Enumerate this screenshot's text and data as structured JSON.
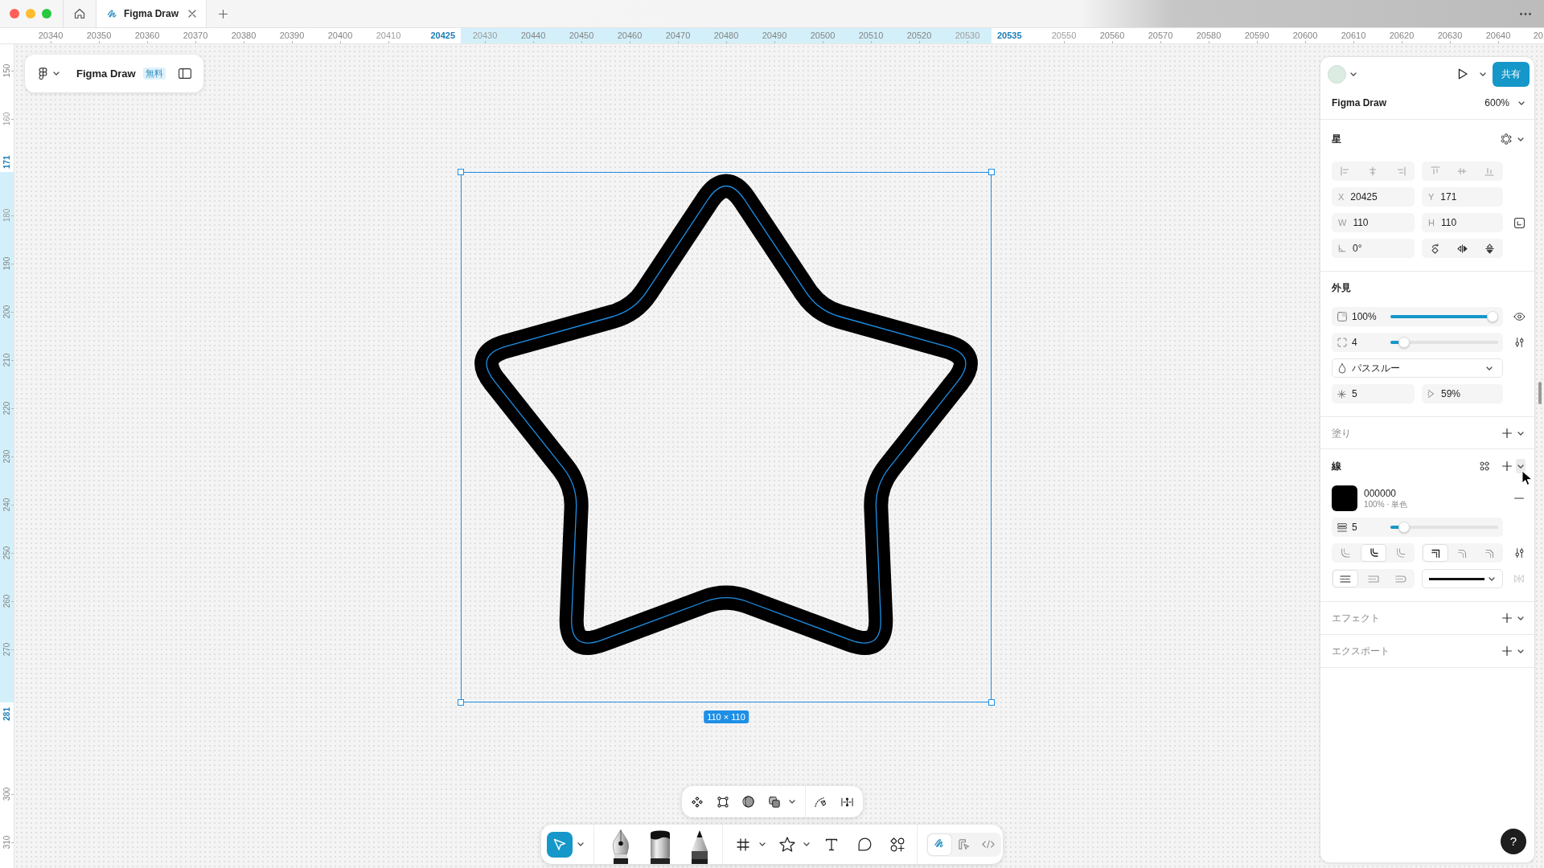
{
  "window": {
    "tabs": [
      {
        "label": "Figma Draw",
        "selected": true
      }
    ]
  },
  "ruler_top": {
    "labels": [
      {
        "text": "20340",
        "kind": "tick"
      },
      {
        "text": "20350",
        "kind": "tick"
      },
      {
        "text": "20360",
        "kind": "tick"
      },
      {
        "text": "20370",
        "kind": "tick"
      },
      {
        "text": "20380",
        "kind": "tick"
      },
      {
        "text": "20390",
        "kind": "tick"
      },
      {
        "text": "20400",
        "kind": "tick"
      },
      {
        "text": "20410",
        "kind": "faded"
      },
      {
        "text": "20425",
        "kind": "selection_start"
      },
      {
        "text": "20430",
        "kind": "faded"
      },
      {
        "text": "20440",
        "kind": "tick"
      },
      {
        "text": "20450",
        "kind": "tick"
      },
      {
        "text": "20460",
        "kind": "tick"
      },
      {
        "text": "20470",
        "kind": "tick"
      },
      {
        "text": "20480",
        "kind": "tick"
      },
      {
        "text": "20490",
        "kind": "tick"
      },
      {
        "text": "20500",
        "kind": "tick"
      },
      {
        "text": "20510",
        "kind": "tick"
      },
      {
        "text": "20520",
        "kind": "tick"
      },
      {
        "text": "20530",
        "kind": "faded"
      },
      {
        "text": "20535",
        "kind": "selection_end"
      },
      {
        "text": "20550",
        "kind": "faded"
      },
      {
        "text": "20560",
        "kind": "tick"
      },
      {
        "text": "20570",
        "kind": "tick"
      },
      {
        "text": "20580",
        "kind": "tick"
      },
      {
        "text": "20590",
        "kind": "tick"
      },
      {
        "text": "20600",
        "kind": "tick"
      },
      {
        "text": "20610",
        "kind": "tick"
      },
      {
        "text": "20620",
        "kind": "tick"
      },
      {
        "text": "20630",
        "kind": "tick"
      },
      {
        "text": "20640",
        "kind": "tick"
      },
      {
        "text": "20",
        "kind": "edge"
      }
    ]
  },
  "ruler_left": {
    "labels": [
      {
        "text": "150",
        "kind": "tick"
      },
      {
        "text": "160",
        "kind": "faded"
      },
      {
        "text": "171",
        "kind": "selection_start"
      },
      {
        "text": "180",
        "kind": "faded"
      },
      {
        "text": "190",
        "kind": "tick"
      },
      {
        "text": "200",
        "kind": "tick"
      },
      {
        "text": "210",
        "kind": "tick"
      },
      {
        "text": "220",
        "kind": "tick"
      },
      {
        "text": "230",
        "kind": "tick"
      },
      {
        "text": "240",
        "kind": "tick"
      },
      {
        "text": "250",
        "kind": "tick"
      },
      {
        "text": "260",
        "kind": "tick"
      },
      {
        "text": "270",
        "kind": "tick"
      },
      {
        "text": "281",
        "kind": "selection_end"
      },
      {
        "text": "300",
        "kind": "tick"
      },
      {
        "text": "310",
        "kind": "tick"
      }
    ]
  },
  "file_card": {
    "title": "Figma Draw",
    "badge": "無料"
  },
  "canvas": {
    "selection_size": "110 × 110"
  },
  "floating_toolbar": {
    "groups": [
      {
        "actions": [
          {
            "kind": "component",
            "menu": false
          },
          {
            "kind": "frame_selection",
            "menu": false
          },
          {
            "kind": "mask",
            "menu": false
          },
          {
            "kind": "boolean",
            "menu": true
          }
        ]
      },
      {
        "actions": [
          {
            "kind": "path_edit",
            "menu": false
          },
          {
            "kind": "distribute",
            "menu": false
          }
        ]
      }
    ]
  },
  "toolbar": {
    "groups": [
      {
        "tools": [
          {
            "kind": "move",
            "selected": true,
            "menu": true
          }
        ]
      },
      {
        "tools": [
          {
            "kind": "pen",
            "selected": false,
            "menu": false
          },
          {
            "kind": "marker",
            "selected": false,
            "menu": false
          },
          {
            "kind": "pencil",
            "selected": false,
            "menu": false
          }
        ]
      },
      {
        "tools": [
          {
            "kind": "frame",
            "selected": false,
            "menu": true
          },
          {
            "kind": "star",
            "selected": false,
            "menu": true
          },
          {
            "kind": "text",
            "selected": false,
            "menu": false
          },
          {
            "kind": "shape",
            "selected": false,
            "menu": false
          },
          {
            "kind": "assets",
            "selected": false,
            "menu": false
          }
        ]
      }
    ],
    "modes": [
      {
        "kind": "draw",
        "selected": true
      },
      {
        "kind": "design",
        "selected": false
      },
      {
        "kind": "dev",
        "selected": false
      }
    ]
  },
  "properties": {
    "header": {
      "share": "共有",
      "file_name": "Figma Draw",
      "zoom": "600%"
    },
    "layer": {
      "title": "星"
    },
    "transform": {
      "x": {
        "label": "X",
        "value": "20425"
      },
      "y": {
        "label": "Y",
        "value": "171"
      },
      "w": {
        "label": "W",
        "value": "110"
      },
      "h": {
        "label": "H",
        "value": "110"
      },
      "rotation": "0°"
    },
    "appearance": {
      "title": "外見",
      "opacity": {
        "value": "100%",
        "level": 1
      },
      "corner_radius": {
        "value": "4",
        "level": 0.08
      },
      "blend_mode": "パススルー",
      "point_count": "5",
      "ratio": "59%"
    },
    "fill": {
      "title": "塗り",
      "empty": true
    },
    "stroke": {
      "title": "線",
      "empty": false,
      "menu_hovered": true,
      "hex_code": "000000",
      "detail": "100% · 単色",
      "weight": {
        "value": "5",
        "level": 0.08
      },
      "position_options": [
        {
          "selected": false
        },
        {
          "selected": true
        },
        {
          "selected": false
        }
      ],
      "join_options": [
        {
          "selected": true
        },
        {
          "selected": false
        },
        {
          "selected": false
        }
      ],
      "cap_options": [
        {
          "selected": true
        },
        {
          "selected": false
        },
        {
          "selected": false
        }
      ]
    },
    "effects": {
      "title": "エフェクト",
      "empty": true
    },
    "export": {
      "title": "エクスポート",
      "empty": true
    }
  },
  "help": {
    "label": "?"
  }
}
